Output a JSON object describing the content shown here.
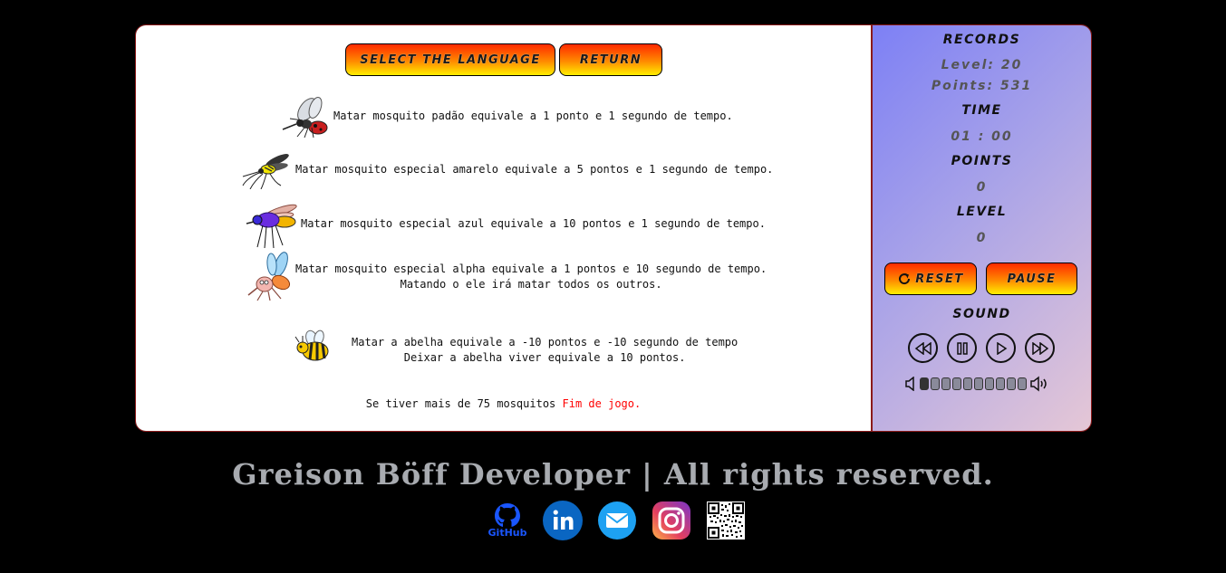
{
  "buttons": {
    "language": "Select the language",
    "return": "Return",
    "reset": "Reset",
    "pause": "Pause"
  },
  "rules": [
    {
      "icon": "red-mosquito-icon",
      "line1": "Matar mosquito padão equivale a 1 ponto e 1 segundo de tempo."
    },
    {
      "icon": "yellow-mosquito-icon",
      "line1": "Matar mosquito especial amarelo equivale a 5 pontos e 1 segundo de tempo."
    },
    {
      "icon": "blue-mosquito-icon",
      "line1": "Matar mosquito especial azul equivale a 10 pontos e 1 segundo de tempo."
    },
    {
      "icon": "alpha-mosquito-icon",
      "line1": "Matar mosquito especial alpha equivale a 1 pontos e 10 segundo de tempo.",
      "line2": "Matando o ele irá matar todos os outros."
    },
    {
      "icon": "bee-icon",
      "line1": "Matar a abelha equivale a -10 pontos e -10 segundo de tempo",
      "line2": "Deixar a abelha viver equivale a 10 pontos."
    }
  ],
  "game_over": {
    "prefix": "Se tiver mais de 75 mosquitos ",
    "highlight": "Fim de jogo.",
    "highlight_color": "#ff0000"
  },
  "sidebar": {
    "records_title": "Records",
    "records_level": "Level: 20",
    "records_points": "Points: 531",
    "time_title": "Time",
    "time_value": "01 : 00",
    "points_title": "Points",
    "points_value": "0",
    "level_title": "Level",
    "level_value": "0",
    "sound_title": "Sound",
    "volume_level": 0.1,
    "volume_segments": 10
  },
  "footer": {
    "text": "Greison Böff Developer | All rights reserved.",
    "github_label": "GitHub"
  },
  "colors": {
    "button_gradient": [
      "#ff2a00",
      "#ff8a00",
      "#ffee00"
    ],
    "border": "#8b1a1a",
    "linkedin": "#0a66c2",
    "email": "#1da1f2",
    "github": "#1a56ff"
  }
}
